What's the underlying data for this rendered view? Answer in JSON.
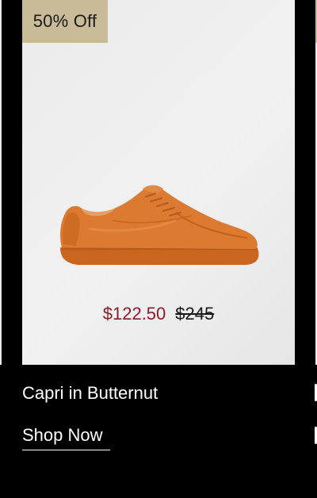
{
  "product": {
    "badge": "50% Off",
    "image_icon": "sneaker-image",
    "image_color": "#d9772e",
    "sale_price": "$122.50",
    "original_price": "$245",
    "name": "Capri in Butternut",
    "cta": "Shop Now"
  },
  "colors": {
    "badge_bg": "#c9ba98",
    "sale_price": "#8a1c2b",
    "page_bg": "#000000"
  }
}
